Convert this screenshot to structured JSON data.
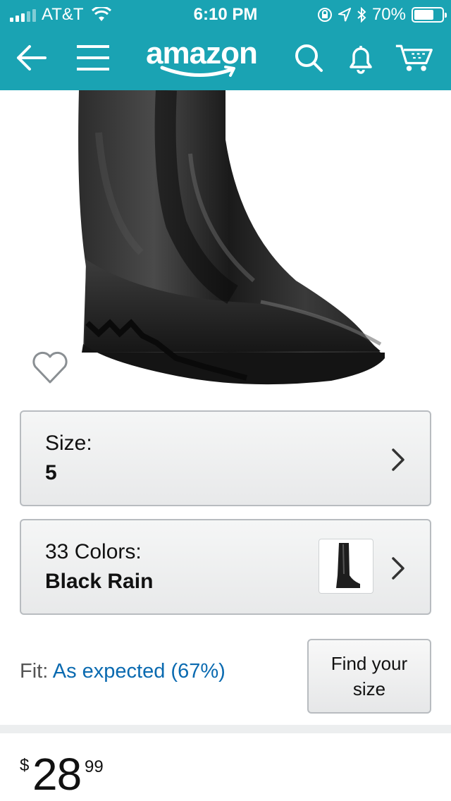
{
  "status_bar": {
    "carrier": "AT&T",
    "time": "6:10 PM",
    "battery_percent": "70%",
    "battery_level": 0.7
  },
  "nav": {
    "logo_text": "amazon",
    "icons": [
      "back-arrow-icon",
      "menu-icon",
      "search-icon",
      "bell-icon",
      "cart-icon"
    ]
  },
  "product": {
    "image_icon": "rain-boot-image",
    "wishlist_icon": "heart-icon"
  },
  "size_option": {
    "label": "Size:",
    "value": "5"
  },
  "color_option": {
    "label": "33 Colors:",
    "value": "Black Rain",
    "swatch_icon": "boot-thumbnail"
  },
  "fit": {
    "label": "Fit:",
    "value": "As expected (67%)"
  },
  "find_size_button": "Find your size",
  "price": {
    "currency": "$",
    "whole": "28",
    "fraction": "99"
  },
  "colors": {
    "header": "#1aa3b3",
    "link": "#0a6ab0"
  }
}
